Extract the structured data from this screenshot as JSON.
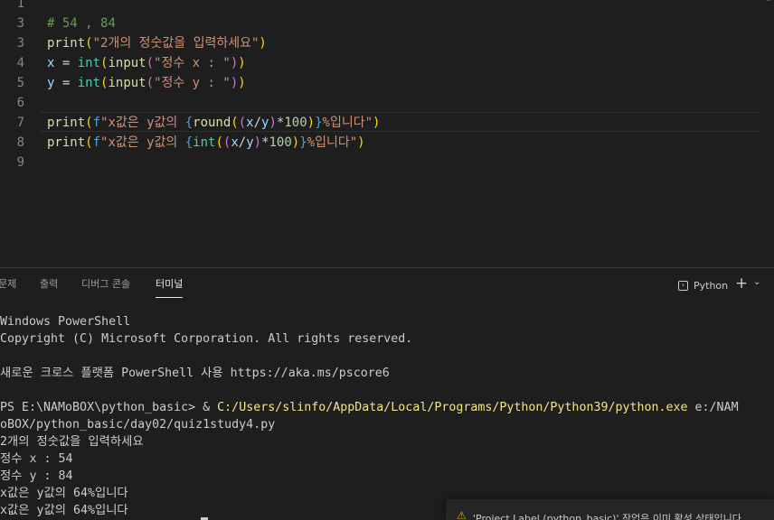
{
  "editor": {
    "lines": [
      {
        "num": "1",
        "code": ""
      },
      {
        "num": "3",
        "code": "# 54 , 84"
      },
      {
        "num": "3",
        "code": "print(\"2개의 정숫값을 입력하세요\")"
      },
      {
        "num": "4",
        "code": "x = int(input(\"정수 x : \"))"
      },
      {
        "num": "5",
        "code": "y = int(input(\"정수 y : \"))"
      },
      {
        "num": "6",
        "code": ""
      },
      {
        "num": "7",
        "code": "print(f\"x값은 y값의 {round((x/y)*100)}%입니다\")"
      },
      {
        "num": "8",
        "code": "print(f\"x값은 y값의 {int((x/y)*100)}%입니다\")"
      },
      {
        "num": "9",
        "code": ""
      }
    ]
  },
  "panel": {
    "tabs": [
      "문제",
      "출력",
      "디버그 콘솔",
      "터미널"
    ],
    "active_tab": "터미널",
    "terminal_kind": "Python",
    "new_terminal_icon": "plus-icon",
    "more_icon": "chevron-down-icon"
  },
  "terminal": {
    "line1": "Windows PowerShell",
    "line2": "Copyright (C) Microsoft Corporation. All rights reserved.",
    "line3": "새로운 크로스 플랫폼 PowerShell 사용 https://aka.ms/pscore6",
    "prompt": "PS E:\\NAMoBOX\\python_basic> & ",
    "exe_path": "C:/Users/slinfo/AppData/Local/Programs/Python/Python39/python.exe",
    "script_arg_1": " e:/NAM",
    "script_arg_2": "oBOX/python_basic/day02/quiz1study4.py",
    "out1": "2개의 정숫값을 입력하세요",
    "out2": "정수 x : 54",
    "out3": "정수 y : 84",
    "out4": "x값은 y값의 64%입니다",
    "out5": "x값은 y값의 64%입니다"
  },
  "notification": {
    "icon": "warning-icon",
    "text": "'Project Label (python_basic)' 작업은 이미 활성 상태입니다"
  },
  "colors": {
    "background": "#1e1e1e",
    "comment": "#6a9955",
    "function": "#dcdcaa",
    "string": "#ce9178",
    "variable": "#9cdcfe",
    "builtin_type": "#4ec9b0",
    "number": "#b5cea8",
    "path_highlight": "#f0e68c",
    "warning": "#cca700"
  }
}
